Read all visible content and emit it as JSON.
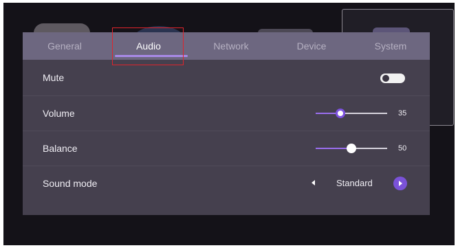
{
  "tabs": [
    {
      "label": "General",
      "active": false
    },
    {
      "label": "Audio",
      "active": true
    },
    {
      "label": "Network",
      "active": false
    },
    {
      "label": "Device",
      "active": false
    },
    {
      "label": "System",
      "active": false
    }
  ],
  "settings": {
    "mute": {
      "label": "Mute",
      "on": false
    },
    "volume": {
      "label": "Volume",
      "value": "35",
      "level": 0.35
    },
    "balance": {
      "label": "Balance",
      "value": "50",
      "level": 0.5
    },
    "sound_mode": {
      "label": "Sound mode",
      "value": "Standard"
    }
  },
  "colors": {
    "accent": "#9b6ff0",
    "tabbar": "#6d6780",
    "panel": "#45404e",
    "highlight": "#e0242c"
  },
  "icons": {
    "prev": "chevron-left-icon",
    "next": "chevron-right-icon"
  }
}
